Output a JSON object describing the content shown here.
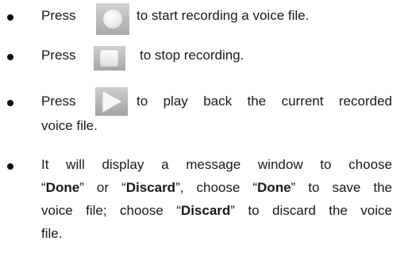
{
  "items": [
    {
      "press": "Press",
      "icon": "record-circle-icon",
      "text": "to start recording a voice file."
    },
    {
      "press": "Press",
      "icon": "stop-square-icon",
      "text": "to stop recording."
    },
    {
      "press": "Press",
      "icon": "play-triangle-icon",
      "text": "to play back the current recorded",
      "text_cont": "voice file."
    },
    {
      "line1": "It will display a message window to choose",
      "q_open": "“",
      "done": "Done",
      "q_close": "”",
      "or": " or ",
      "discard": "Discard",
      "choose": ", choose ",
      "done_save": " to save the",
      "line3_a": "voice file; choose ",
      "line3_b": " to discard the voice",
      "line4": "file."
    }
  ]
}
